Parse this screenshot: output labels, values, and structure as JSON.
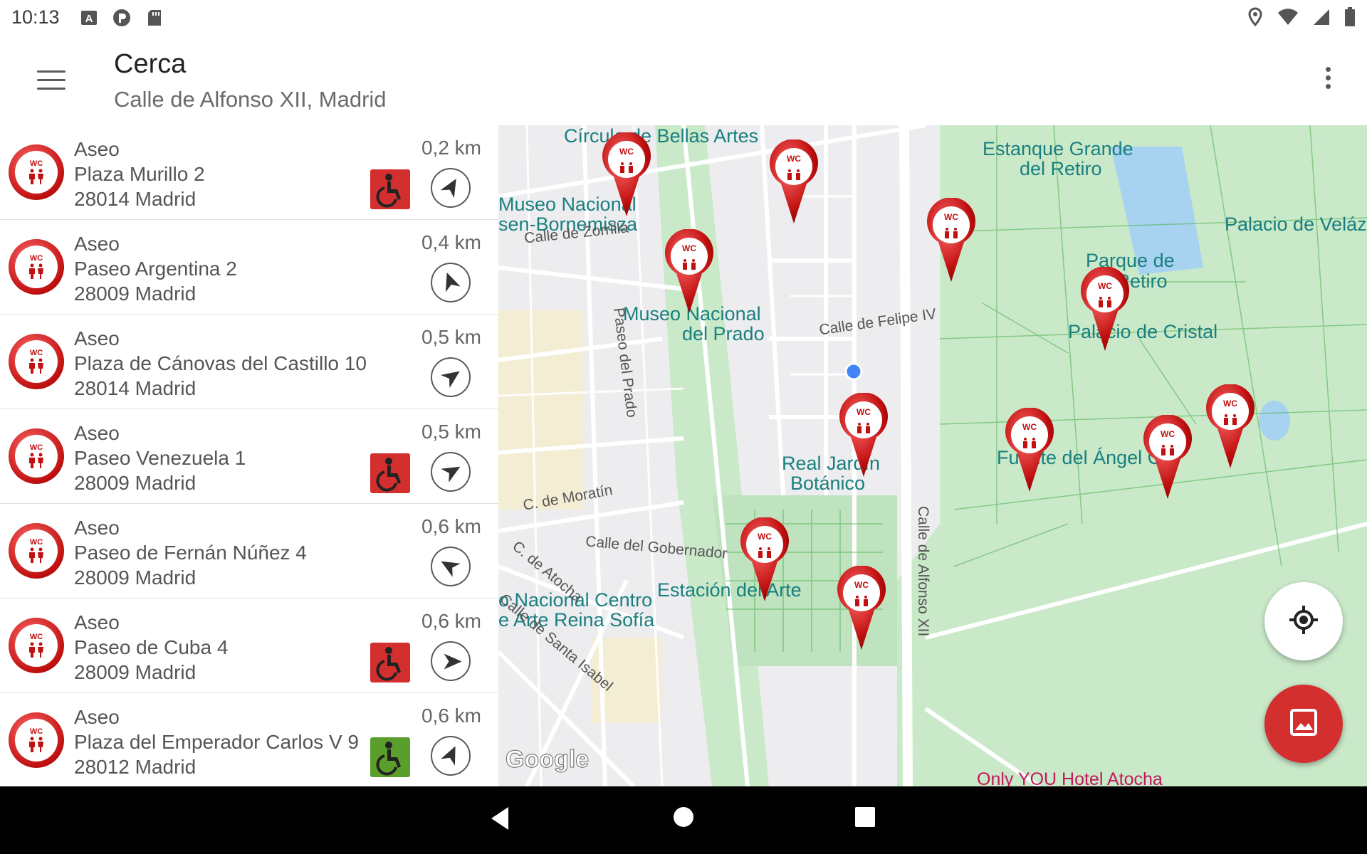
{
  "status_bar": {
    "time": "10:13",
    "left_icons": [
      "font-icon",
      "pocket-icon",
      "sd-card-icon"
    ],
    "right_icons": [
      "location-icon",
      "wifi-icon",
      "signal-icon",
      "battery-icon"
    ]
  },
  "app_bar": {
    "title": "Cerca",
    "subtitle": "Calle de Alfonso XII, Madrid",
    "menu_icon": "hamburger-icon",
    "overflow_icon": "more-vert-icon"
  },
  "colors": {
    "accent_red": "#d32f2f",
    "accessible_red": "#d32f2f",
    "accessible_green": "#5a9e2c",
    "park_green": "#c9e9c9",
    "map_label_teal": "#1a7f7f"
  },
  "list": [
    {
      "type": "Aseo",
      "street": "Plaza Murillo 2",
      "city": "28014 Madrid",
      "distance": "0,2 km",
      "accessible": "red",
      "nav_rotation": 30
    },
    {
      "type": "Aseo",
      "street": "Paseo Argentina 2",
      "city": "28009 Madrid",
      "distance": "0,4 km",
      "accessible": "none",
      "nav_rotation": -20
    },
    {
      "type": "Aseo",
      "street": "Plaza de Cánovas del Castillo 10",
      "city": "28014 Madrid",
      "distance": "0,5 km",
      "accessible": "none",
      "nav_rotation": 55
    },
    {
      "type": "Aseo",
      "street": "Paseo Venezuela 1",
      "city": "28009 Madrid",
      "distance": "0,5 km",
      "accessible": "red",
      "nav_rotation": 60
    },
    {
      "type": "Aseo",
      "street": "Paseo de Fernán Núñez 4",
      "city": "28009 Madrid",
      "distance": "0,6 km",
      "accessible": "none",
      "nav_rotation": -60
    },
    {
      "type": "Aseo",
      "street": "Paseo de Cuba 4",
      "city": "28009 Madrid",
      "distance": "0,6 km",
      "accessible": "red",
      "nav_rotation": 90
    },
    {
      "type": "Aseo",
      "street": "Plaza del Emperador Carlos V 9",
      "city": "28012 Madrid",
      "distance": "0,6 km",
      "accessible": "green",
      "nav_rotation": 25
    }
  ],
  "map": {
    "labels": {
      "bellas_artes": "Círculo de Bellas Artes",
      "estanque_1": "Estanque Grande",
      "estanque_2": "del Retiro",
      "museo_tb_1": "Museo Nacional",
      "museo_tb_2": "sen-Bornemisza",
      "palacio_velaz": "Palacio de Veláz",
      "parque_1": "Parque de",
      "parque_2": "El Retiro",
      "museo_prado_1": "Museo Nacional",
      "museo_prado_2": "del Prado",
      "palacio_cristal": "Palacio de Cristal",
      "jardin_1": "Real Jardín",
      "jardin_2": "Botánico",
      "fuente": "Fuente del Ángel Caí",
      "reina_1": "o Nacional Centro",
      "reina_2": "e Arte Reina Sofía",
      "estacion": "Estación del Arte",
      "hotel": "Only YOU Hotel Atocha",
      "google": "Google"
    },
    "streets": {
      "zorrilla": "Calle de Zorrilla",
      "felipe": "Calle de Felipe IV",
      "prado": "Paseo del Prado",
      "moratin": "C. de Moratín",
      "gobernador": "Calle del Gobernador",
      "atocha": "C. de Atocha",
      "santa_isabel": "Calle de Santa Isabel",
      "alfonso": "Calle de Alfonso XII"
    },
    "pin_label": "WC"
  },
  "fabs": {
    "location_icon": "my-location-icon",
    "image_icon": "image-icon"
  },
  "navbar": {
    "icons": [
      "back-icon",
      "home-icon",
      "recents-icon"
    ]
  }
}
